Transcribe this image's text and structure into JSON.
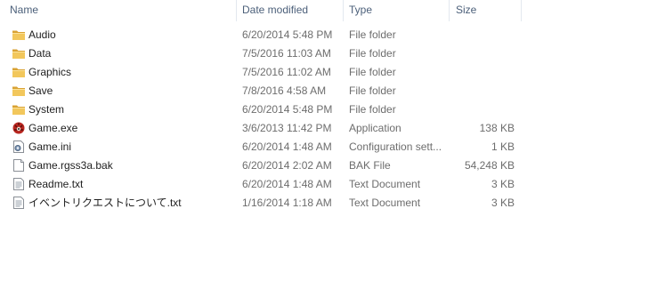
{
  "columns": {
    "name": "Name",
    "date_modified": "Date modified",
    "type": "Type",
    "size": "Size"
  },
  "files": [
    {
      "name": "Audio",
      "date": "6/20/2014 5:48 PM",
      "type": "File folder",
      "size": "",
      "icon": "folder-icon"
    },
    {
      "name": "Data",
      "date": "7/5/2016 11:03 AM",
      "type": "File folder",
      "size": "",
      "icon": "folder-icon"
    },
    {
      "name": "Graphics",
      "date": "7/5/2016 11:02 AM",
      "type": "File folder",
      "size": "",
      "icon": "folder-icon"
    },
    {
      "name": "Save",
      "date": "7/8/2016 4:58 AM",
      "type": "File folder",
      "size": "",
      "icon": "folder-icon"
    },
    {
      "name": "System",
      "date": "6/20/2014 5:48 PM",
      "type": "File folder",
      "size": "",
      "icon": "folder-icon"
    },
    {
      "name": "Game.exe",
      "date": "3/6/2013 11:42 PM",
      "type": "Application",
      "size": "138 KB",
      "icon": "application-icon"
    },
    {
      "name": "Game.ini",
      "date": "6/20/2014 1:48 AM",
      "type": "Configuration sett...",
      "size": "1 KB",
      "icon": "settings-file-icon"
    },
    {
      "name": "Game.rgss3a.bak",
      "date": "6/20/2014 2:02 AM",
      "type": "BAK File",
      "size": "54,248 KB",
      "icon": "blank-file-icon"
    },
    {
      "name": "Readme.txt",
      "date": "6/20/2014 1:48 AM",
      "type": "Text Document",
      "size": "3 KB",
      "icon": "text-file-icon"
    },
    {
      "name": "イベントリクエストについて.txt",
      "date": "1/16/2014 1:18 AM",
      "type": "Text Document",
      "size": "3 KB",
      "icon": "text-file-icon"
    }
  ],
  "colors": {
    "header_text": "#4c607a",
    "detail_text": "#6d6d6d",
    "folder": "#e8b84a"
  }
}
